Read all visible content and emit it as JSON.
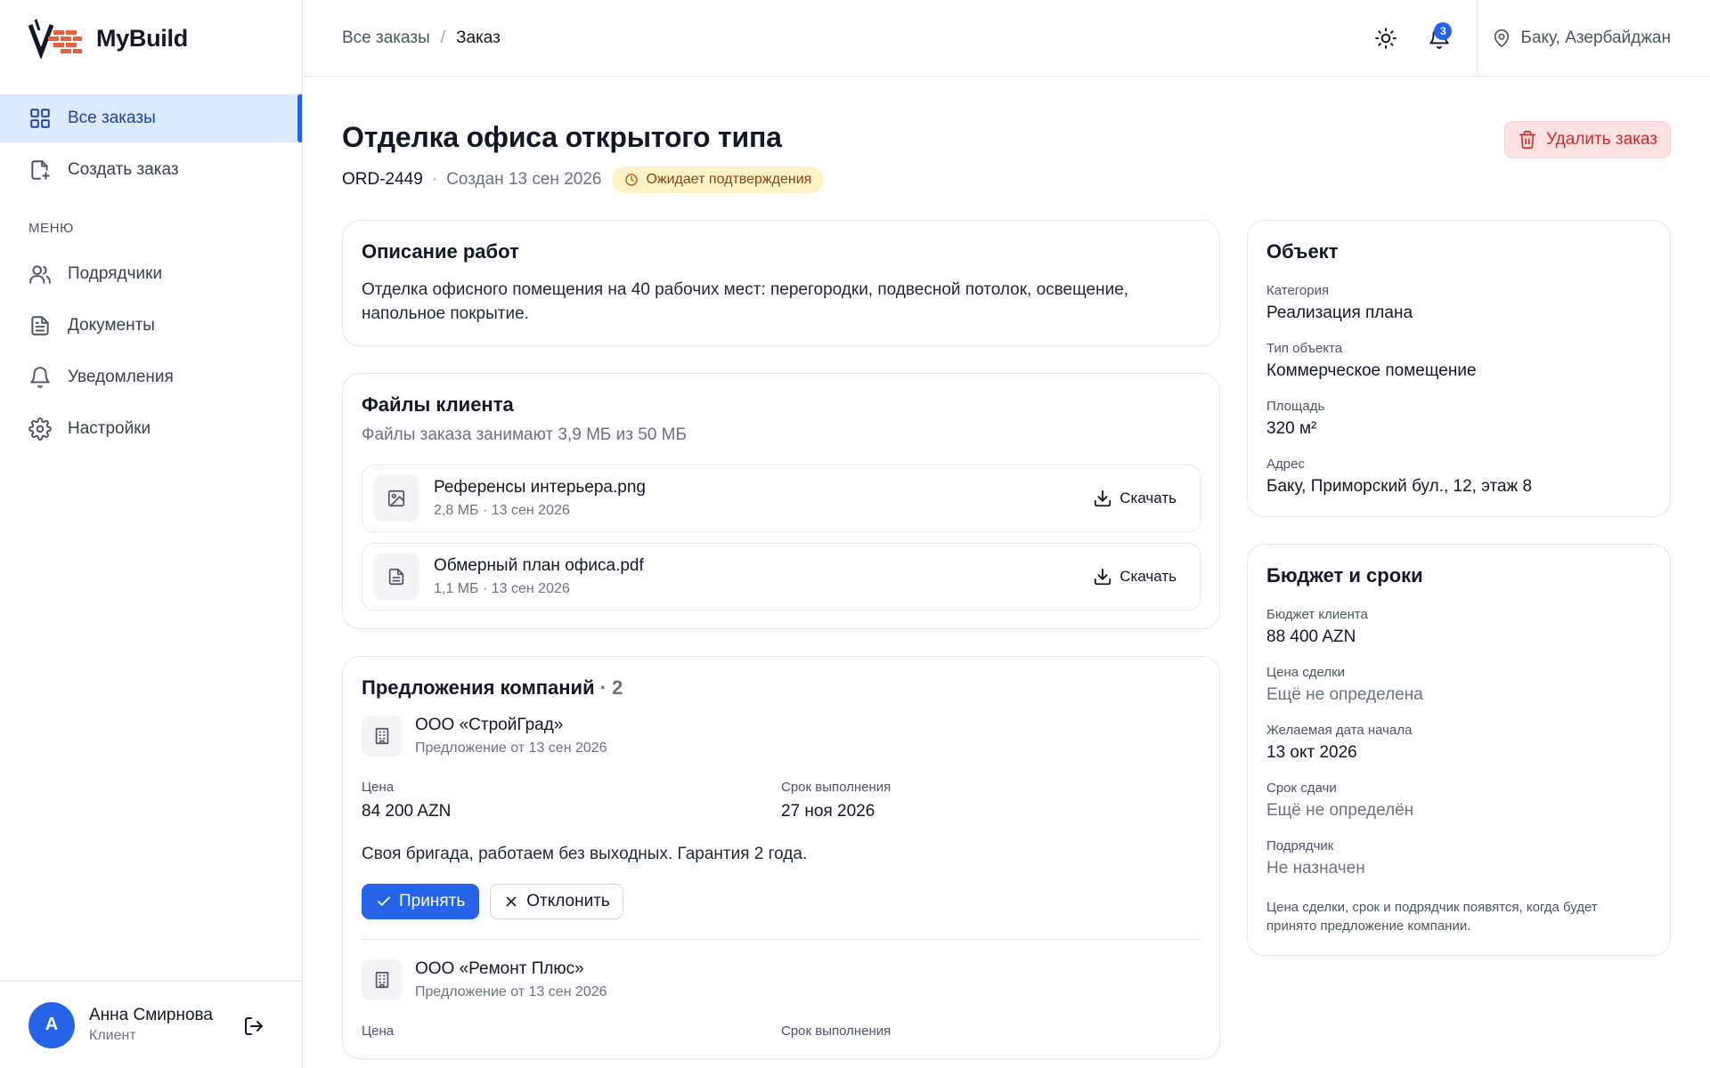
{
  "brand": {
    "name": "MyBuild",
    "accent": "#2563eb"
  },
  "sidebar": {
    "items": [
      {
        "label": "Все заказы",
        "icon": "grid-icon",
        "active": true
      },
      {
        "label": "Создать заказ",
        "icon": "file-plus-icon"
      }
    ],
    "section_label": "МЕНЮ",
    "menu": [
      {
        "label": "Подрядчики",
        "icon": "users-icon"
      },
      {
        "label": "Документы",
        "icon": "document-icon"
      },
      {
        "label": "Уведомления",
        "icon": "bell-icon"
      },
      {
        "label": "Настройки",
        "icon": "gear-icon"
      }
    ],
    "user": {
      "initial": "А",
      "name": "Анна Смирнова",
      "role": "Клиент"
    }
  },
  "header": {
    "breadcrumb": {
      "parent": "Все заказы",
      "separator": "/",
      "current": "Заказ"
    },
    "notifications_count": "3",
    "location": "Баку, Азербайджан"
  },
  "order": {
    "title": "Отделка офиса открытого типа",
    "id": "ORD-2449",
    "meta_sep": "·",
    "created": "Создан 13 сен 2026",
    "status": "Ожидает подтверждения",
    "delete_label": "Удалить заказ"
  },
  "description": {
    "title": "Описание работ",
    "text": "Отделка офисного помещения на 40 рабочих мест: перегородки, подвесной потолок, освещение, напольное покрытие."
  },
  "files": {
    "title": "Файлы клиента",
    "usage": "Файлы заказа занимают 3,9 МБ из 50 МБ",
    "download_label": "Скачать",
    "items": [
      {
        "name": "Референсы интерьера.png",
        "meta": "2,8 МБ · 13 сен 2026",
        "icon": "image-icon"
      },
      {
        "name": "Обмерный план офиса.pdf",
        "meta": "1,1 МБ · 13 сен 2026",
        "icon": "document-icon"
      }
    ]
  },
  "offers": {
    "title": "Предложения компаний",
    "count": "· 2",
    "price_label": "Цена",
    "term_label": "Срок выполнения",
    "accept_label": "Принять",
    "reject_label": "Отклонить",
    "items": [
      {
        "company": "ООО «СтройГрад»",
        "date": "Предложение от 13 сен 2026",
        "price": "84 200 AZN",
        "term": "27 ноя 2026",
        "note": "Своя бригада, работаем без выходных. Гарантия 2 года."
      },
      {
        "company": "ООО «Ремонт Плюс»",
        "date": "Предложение от 13 сен 2026"
      }
    ]
  },
  "object": {
    "title": "Объект",
    "fields": [
      {
        "label": "Категория",
        "value": "Реализация плана"
      },
      {
        "label": "Тип объекта",
        "value": "Коммерческое помещение"
      },
      {
        "label": "Площадь",
        "value": "320 м²"
      },
      {
        "label": "Адрес",
        "value": "Баку, Приморский бул., 12, этаж 8"
      }
    ]
  },
  "budget": {
    "title": "Бюджет и сроки",
    "fields": [
      {
        "label": "Бюджет клиента",
        "value": "88 400 AZN"
      },
      {
        "label": "Цена сделки",
        "value": "Ещё не определена"
      },
      {
        "label": "Желаемая дата начала",
        "value": "13 окт 2026"
      },
      {
        "label": "Срок сдачи",
        "value": "Ещё не определён"
      },
      {
        "label": "Подрядчик",
        "value": "Не назначен"
      }
    ],
    "footnote": "Цена сделки, срок и подрядчик появятся, когда будет принято предложение компании."
  }
}
